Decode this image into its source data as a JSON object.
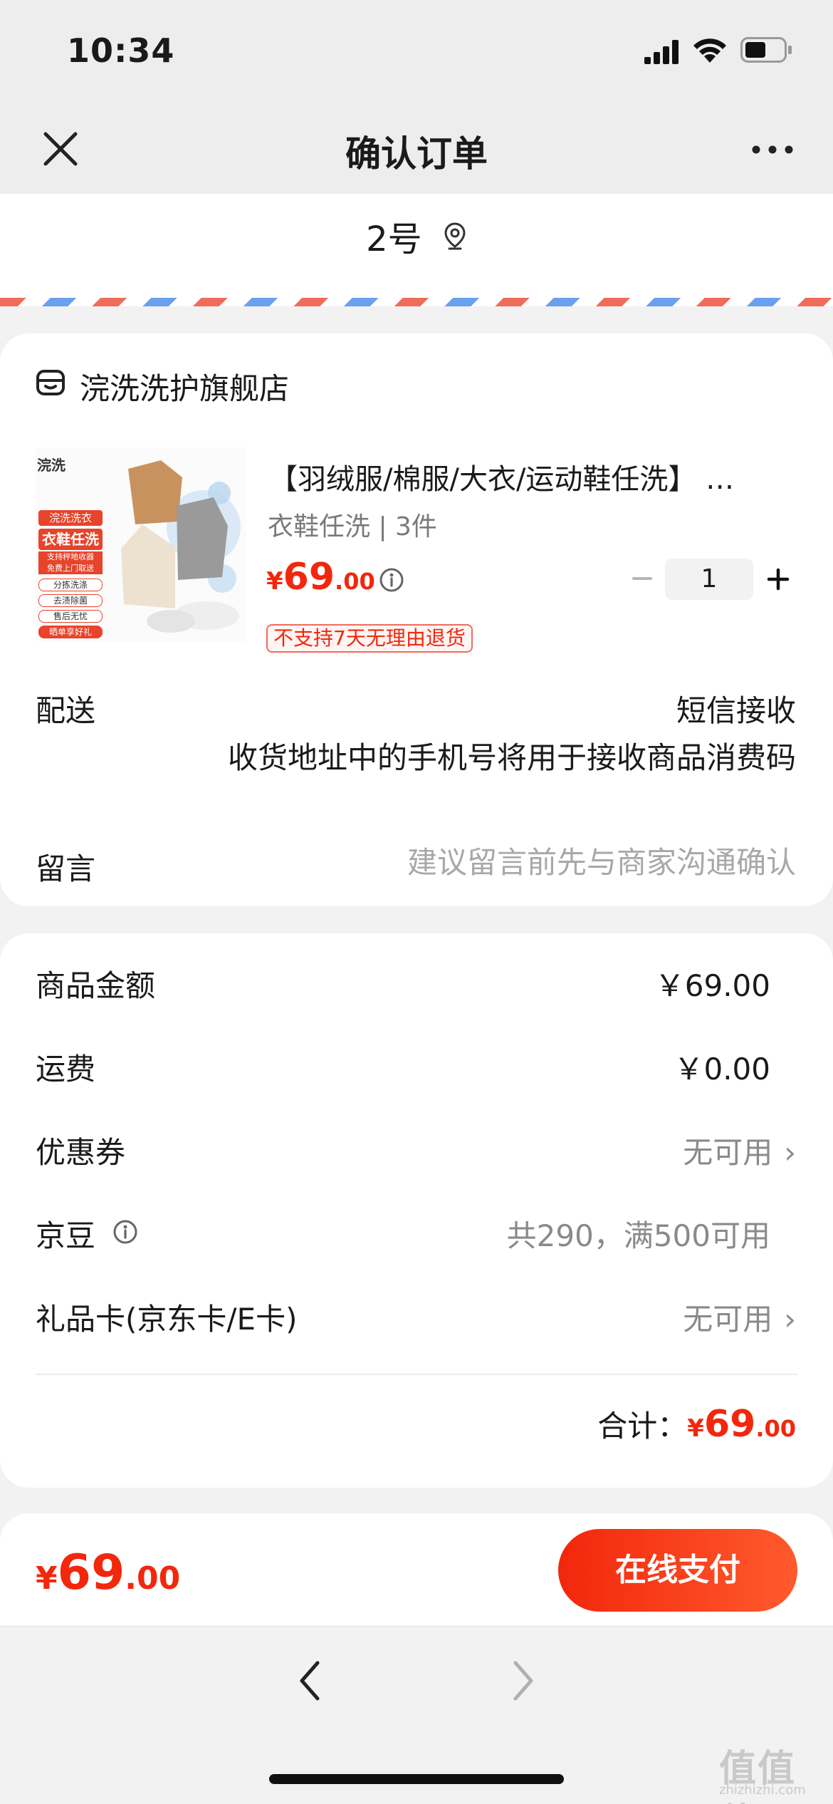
{
  "status": {
    "time": "10:34"
  },
  "nav": {
    "title": "确认订单"
  },
  "address": {
    "text": "2号"
  },
  "store": {
    "name": "浣洗洗护旗舰店"
  },
  "product": {
    "image_brand": "浣洗",
    "image_lines": [
      "浣洗洗衣",
      "衣鞋任洗",
      "支持秤地收器",
      "免费上门取送",
      "分拣洗涤",
      "去渍除菌",
      "售后无忧",
      "晒单享好礼"
    ],
    "title": "【羽绒服/棉服/大衣/运动鞋任洗】 …",
    "spec": "衣鞋任洗 | 3件",
    "price_symbol": "¥",
    "price_int": "69",
    "price_dec": ".00",
    "qty": "1",
    "return_tag": "不支持7天无理由退货"
  },
  "delivery": {
    "label": "配送",
    "value": "短信接收",
    "note": "收货地址中的手机号将用于接收商品消费码"
  },
  "message": {
    "label": "留言",
    "placeholder": "建议留言前先与商家沟通确认"
  },
  "summary": {
    "goods_label": "商品金额",
    "goods_value": "￥69.00",
    "shipping_label": "运费",
    "shipping_value": "￥0.00",
    "coupon_label": "优惠券",
    "coupon_value": "无可用",
    "jingdou_label": "京豆",
    "jingdou_value": "共290，满500可用",
    "giftcard_label": "礼品卡(京东卡/E卡)",
    "giftcard_value": "无可用",
    "total_label": "合计：",
    "total_symbol": "¥",
    "total_int": "69",
    "total_dec": ".00"
  },
  "pay": {
    "symbol": "¥",
    "int": "69",
    "dec": ".00",
    "button": "在线支付"
  },
  "watermark": {
    "main": "值值值",
    "sub": "zhizhizhi.com"
  },
  "colors": {
    "accent": "#f2270c",
    "page_bg": "#f2f2f2"
  }
}
